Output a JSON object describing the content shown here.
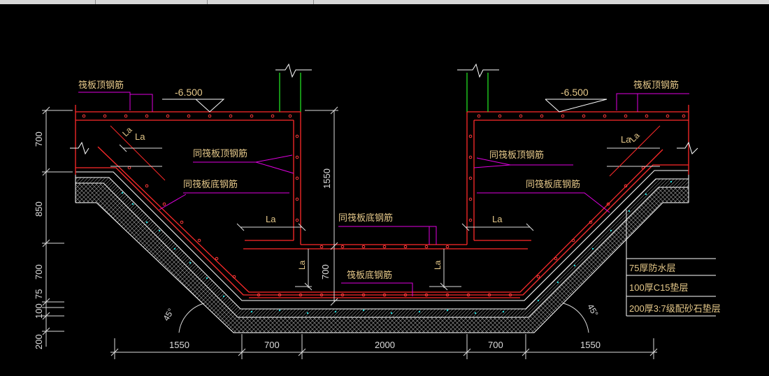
{
  "window": {
    "tabs": [
      "",
      "",
      ""
    ]
  },
  "colors": {
    "background": "#000000",
    "wall": "#ff2a2a",
    "rebar_dot": "#ff3b3b",
    "annotation": "#e6c98a",
    "leader": "#e000e0",
    "column": "#22dd22",
    "dimension": "#dddddd",
    "layer_line": "#ffffff",
    "hatch": "#8a8a8a",
    "cyan_fill": "#22dddd"
  },
  "labels": {
    "raft_top_rebar_left": "筏板顶钢筋",
    "raft_top_rebar_right": "筏板顶钢筋",
    "elevation_left": "-6.500",
    "elevation_right": "-6.500",
    "la_a_left": "La",
    "la_b_left": "La",
    "la_a_right": "La",
    "la_b_right": "La",
    "same_top_left": "同筏板顶钢筋",
    "same_top_right": "同筏板顶钢筋",
    "same_bottom_left": "同筏板底钢筋",
    "same_bottom_right": "同筏板底钢筋",
    "same_bottom_center": "同筏板底钢筋",
    "raft_bottom_rebar": "筏板底钢筋",
    "la_left": "La",
    "la_right": "La",
    "la_vert_left": "La",
    "la_vert_right": "La"
  },
  "dimensions": {
    "left_vertical": [
      "700",
      "850",
      "700",
      "75",
      "100",
      "200"
    ],
    "pit_depth": "1550",
    "inner_height": "700",
    "bottom": [
      "1550",
      "700",
      "2000",
      "700",
      "1550"
    ]
  },
  "angles": {
    "left": "45°",
    "right": "45°"
  },
  "legend": {
    "layers": [
      "75厚防水层",
      "100厚C15垫层",
      "200厚3:7级配砂石垫层"
    ]
  }
}
